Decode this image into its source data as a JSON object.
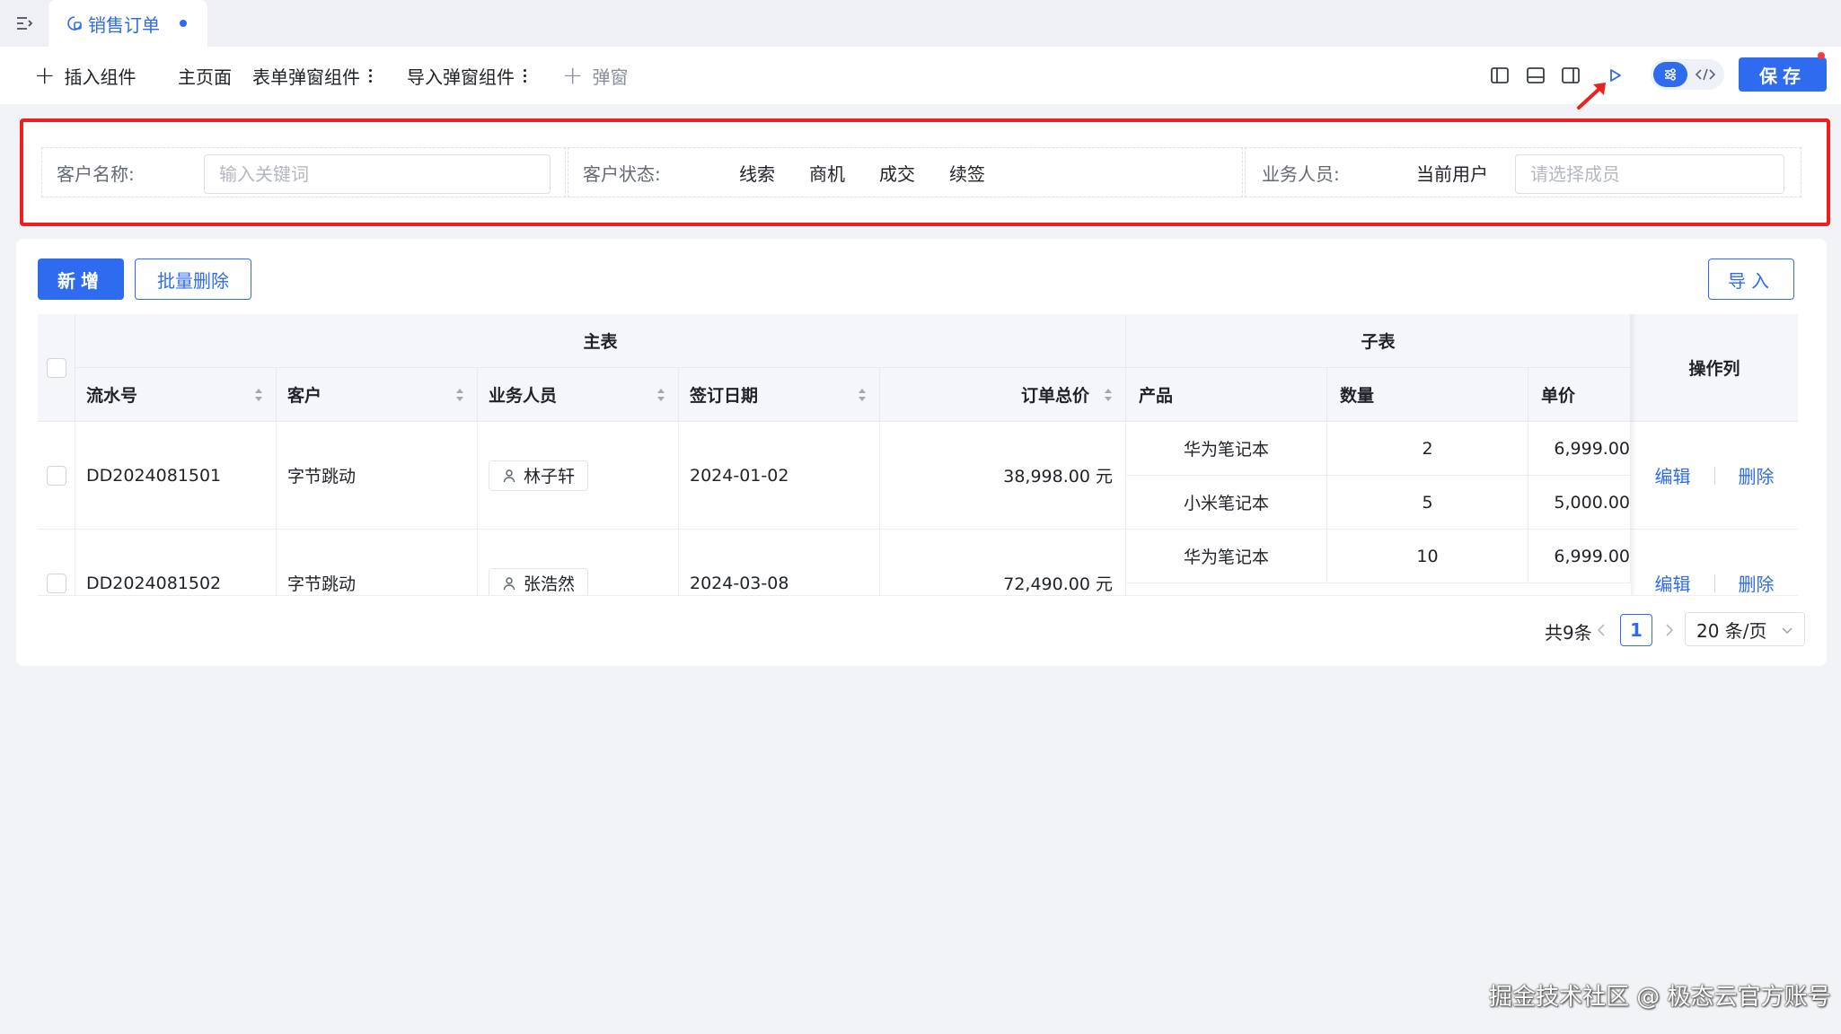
{
  "tab": {
    "title": "销售订单"
  },
  "toolbar": {
    "insert_component": "插入组件",
    "main_page": "主页面",
    "form_popup": "表单弹窗组件",
    "import_popup": "导入弹窗组件",
    "popup": "弹窗",
    "save": "保存"
  },
  "filters": {
    "customer_name": {
      "label": "客户名称:",
      "placeholder": "输入关键词"
    },
    "customer_status": {
      "label": "客户状态:",
      "options": [
        "线索",
        "商机",
        "成交",
        "续签"
      ]
    },
    "salesperson": {
      "label": "业务人员:",
      "current_user": "当前用户",
      "placeholder": "请选择成员"
    }
  },
  "actions": {
    "add": "新增",
    "batch_delete": "批量删除",
    "import": "导入"
  },
  "table": {
    "group_main": "主表",
    "group_sub": "子表",
    "group_ops": "操作列",
    "columns": [
      "流水号",
      "客户",
      "业务人员",
      "签订日期",
      "订单总价",
      "产品",
      "数量",
      "单价"
    ],
    "rows": [
      {
        "serial": "DD2024081501",
        "customer": "字节跳动",
        "salesperson": "林子轩",
        "date": "2024-01-02",
        "total": "38,998.00 元",
        "items": [
          {
            "product": "华为笔记本",
            "qty": "2",
            "price": "6,999.00"
          },
          {
            "product": "小米笔记本",
            "qty": "5",
            "price": "5,000.00"
          }
        ],
        "edit": "编辑",
        "delete": "删除"
      },
      {
        "serial": "DD2024081502",
        "customer": "字节跳动",
        "salesperson": "张浩然",
        "date": "2024-03-08",
        "total": "72,490.00 元",
        "items": [
          {
            "product": "华为笔记本",
            "qty": "10",
            "price": "6,999.00"
          }
        ],
        "edit": "编辑",
        "delete": "删除"
      }
    ]
  },
  "pagination": {
    "total": "共9条",
    "current_page": "1",
    "page_size": "20 条/页"
  },
  "watermark": "掘金技术社区 @ 极态云官方账号",
  "colors": {
    "primary": "#2f6bef",
    "highlight_border": "#f21d1d",
    "annotation_arrow": "#e8231f"
  }
}
